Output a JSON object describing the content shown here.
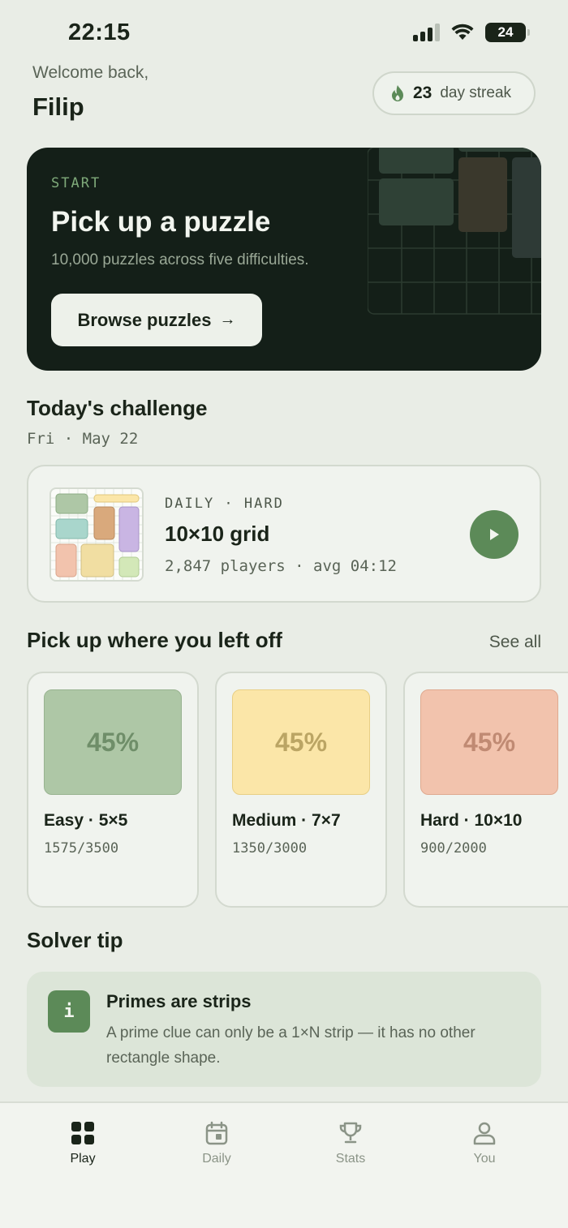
{
  "status_bar": {
    "time": "22:15",
    "battery": "24"
  },
  "header": {
    "welcome": "Welcome back,",
    "username": "Filip",
    "streak_count": "23",
    "streak_label": "day streak"
  },
  "hero": {
    "eyebrow": "START",
    "title": "Pick up a puzzle",
    "subtitle": "10,000 puzzles across five difficulties.",
    "button_label": "Browse puzzles",
    "button_arrow": "→"
  },
  "today": {
    "title": "Today's challenge",
    "date": "Fri · May 22",
    "tag": "DAILY · HARD",
    "puzzle_title": "10×10 grid",
    "meta": "2,847 players · avg 04:12"
  },
  "continue": {
    "title": "Pick up where you left off",
    "see_all": "See all",
    "cards": [
      {
        "percent": "45%",
        "label": "Easy · 5×5",
        "count": "1575/3500",
        "color": "#aec7a6",
        "text_color": "#6f8e69"
      },
      {
        "percent": "45%",
        "label": "Medium · 7×7",
        "count": "1350/3000",
        "color": "#fbe6a8",
        "text_color": "#bba564"
      },
      {
        "percent": "45%",
        "label": "Hard · 10×10",
        "count": "900/2000",
        "color": "#f2c3ad",
        "text_color": "#c08a73"
      }
    ]
  },
  "tip": {
    "section_title": "Solver tip",
    "icon": "i",
    "title": "Primes are strips",
    "body": "A prime clue can only be a 1×N strip — it has no other rectangle shape."
  },
  "tabs": [
    {
      "label": "Play",
      "icon": "grid-icon",
      "active": true
    },
    {
      "label": "Daily",
      "icon": "calendar-icon",
      "active": false
    },
    {
      "label": "Stats",
      "icon": "trophy-icon",
      "active": false
    },
    {
      "label": "You",
      "icon": "user-icon",
      "active": false
    }
  ],
  "colors": {
    "accent": "#5c8a58",
    "hero_bg": "#141f18",
    "background": "#e9ede6"
  }
}
